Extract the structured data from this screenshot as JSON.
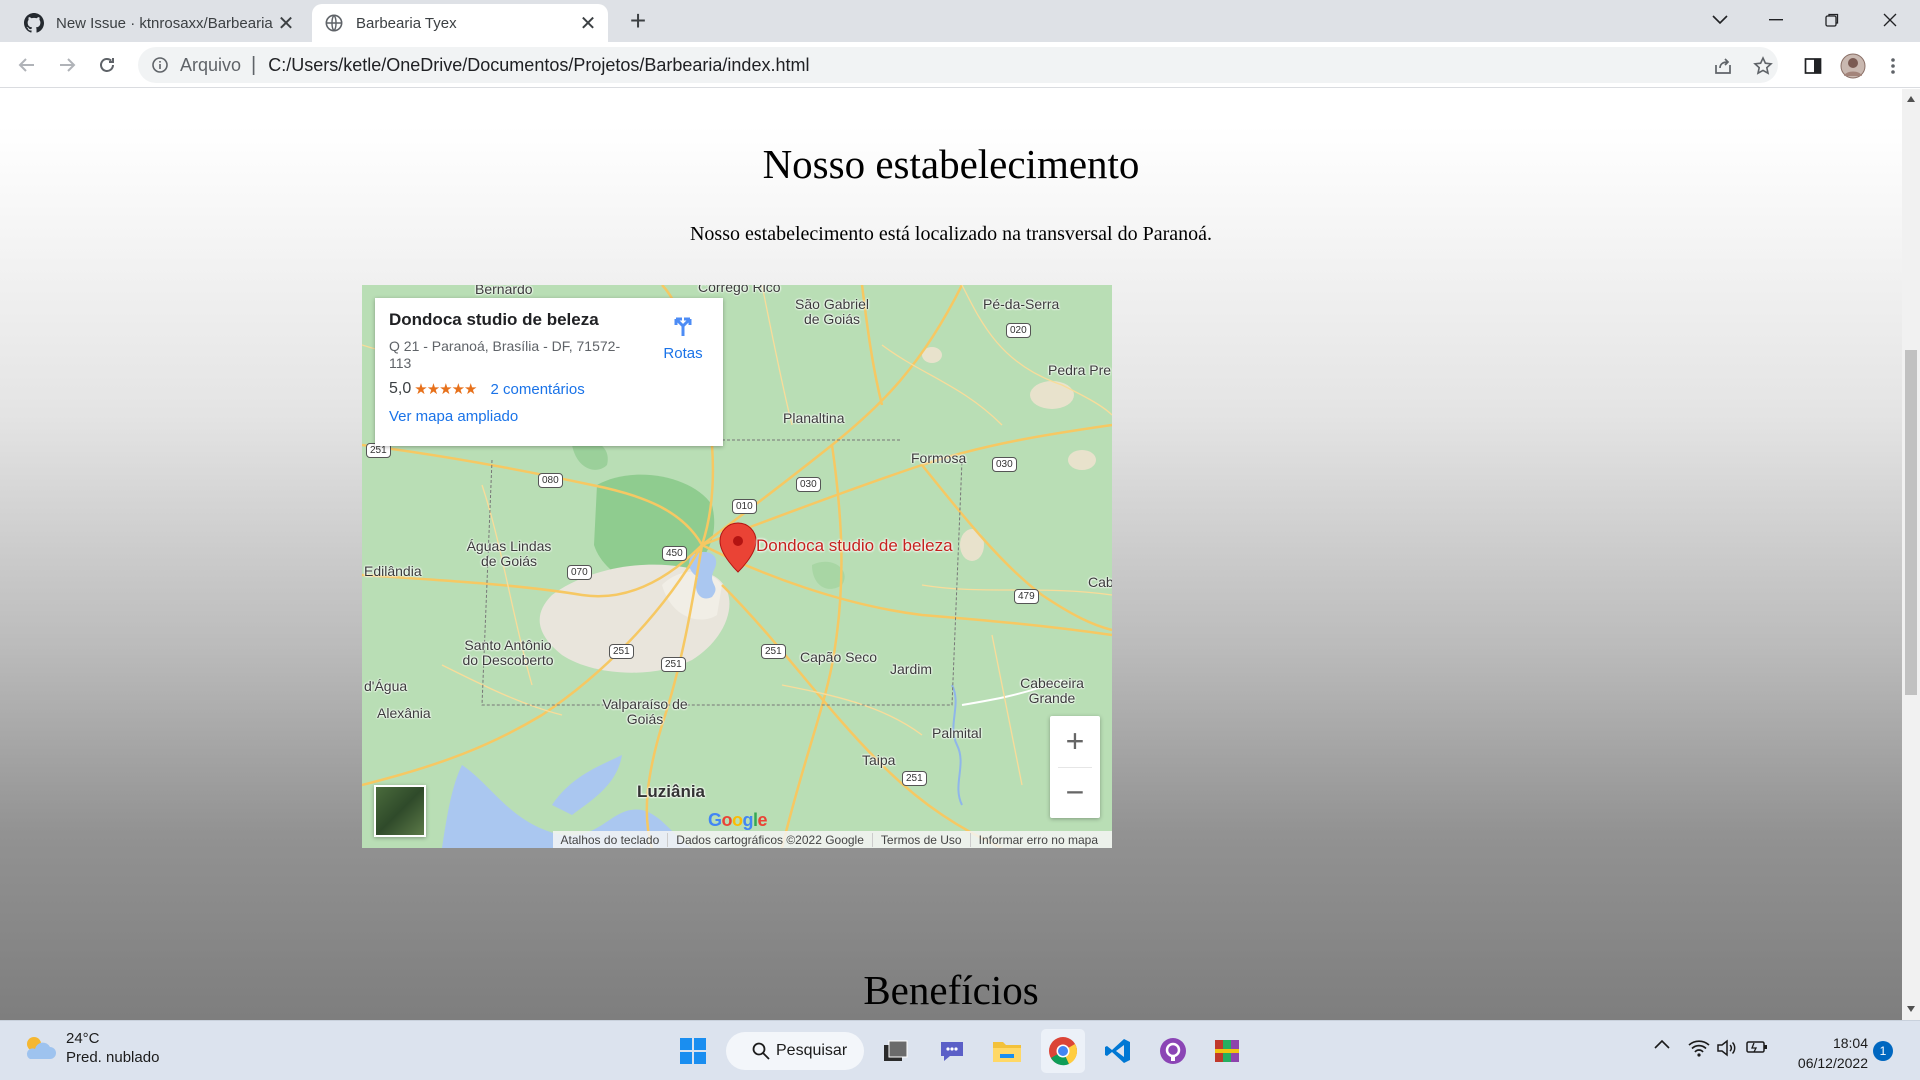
{
  "browser": {
    "tabs": [
      {
        "title": "New Issue · ktnrosaxx/Barbearia",
        "icon": "github-icon"
      },
      {
        "title": "Barbearia Tyex",
        "icon": "globe-icon"
      }
    ],
    "omnibox": {
      "scheme_label": "Arquivo",
      "separator": "|",
      "url": "C:/Users/ketle/OneDrive/Documentos/Projetos/Barbearia/index.html"
    }
  },
  "page": {
    "establishment_heading": "Nosso estabelecimento",
    "establishment_text": "Nosso estabelecimento está localizado na transversal do Paranoá.",
    "benefits_heading": "Benefícios"
  },
  "map": {
    "place_name": "Dondoca studio de beleza",
    "address": "Q 21 - Paranoá, Brasília - DF, 71572-113",
    "rating": "5,0",
    "stars": "★★★★★",
    "reviews_link": "2 comentários",
    "directions_label": "Rotas",
    "larger_map_link": "Ver mapa ampliado",
    "pin_label": "Dondoca studio de beleza",
    "zoom_in": "+",
    "zoom_out": "−",
    "google_logo": [
      "G",
      "o",
      "o",
      "g",
      "l",
      "e"
    ],
    "footer": [
      "Atalhos do teclado",
      "Dados cartográficos ©2022 Google",
      "Termos de Uso",
      "Informar erro no mapa"
    ],
    "places": [
      "Bernardo",
      "Córrego Rico",
      "São Gabriel de Goiás",
      "Pé-da-Serra",
      "Pedra Pre",
      "Planaltina",
      "Formosa",
      "Águas Lindas de Goiás",
      "Edilândia",
      "Cab",
      "Santo Antônio do Descoberto",
      "Capão Seco",
      "Jardim",
      "Cabeceira Grande",
      "d'Água",
      "Alexânia",
      "Valparaíso de Goiás",
      "Palmital",
      "Taipa",
      "Luziânia"
    ],
    "road_shields": [
      "020",
      "251",
      "080",
      "030",
      "030",
      "010",
      "450",
      "070",
      "479",
      "251",
      "251",
      "251",
      "251"
    ]
  },
  "taskbar": {
    "weather_temp": "24°C",
    "weather_desc": "Pred. nublado",
    "search_label": "Pesquisar",
    "time": "18:04",
    "date": "06/12/2022",
    "notification_count": "1"
  },
  "colors": {
    "accent_blue": "#1a73e8",
    "pin_red": "#ea4335",
    "star_orange": "#e7711b",
    "map_green": "#b4dcb2"
  }
}
